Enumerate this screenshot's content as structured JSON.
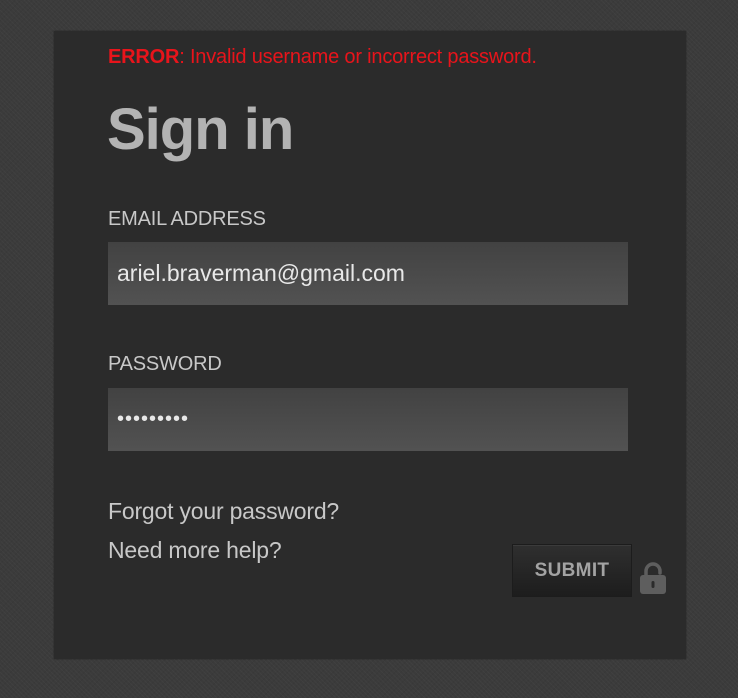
{
  "error": {
    "label": "ERROR",
    "message": ": Invalid username or incorrect password."
  },
  "title": "Sign in",
  "email": {
    "label": "EMAIL ADDRESS",
    "value": "ariel.braverman@gmail.com"
  },
  "password": {
    "label": "PASSWORD",
    "value": "•••••••••"
  },
  "links": {
    "forgot": "Forgot your password?",
    "help": "Need more help?"
  },
  "submit_label": "SUBMIT",
  "icons": {
    "lock": "lock-icon"
  },
  "colors": {
    "error": "#e8141b",
    "panel": "#2b2b2b",
    "background": "#3b3b3b",
    "title": "#b3b3b3"
  }
}
